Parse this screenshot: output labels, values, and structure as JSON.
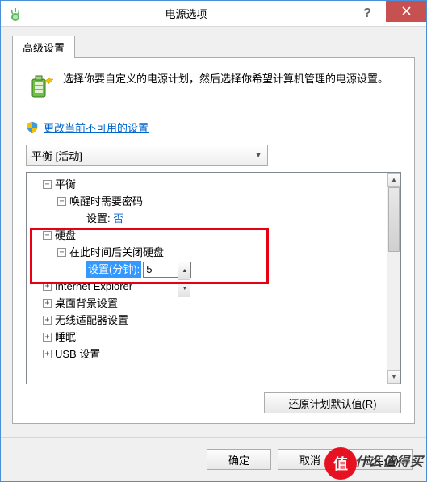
{
  "window": {
    "title": "电源选项"
  },
  "tab": {
    "label": "高级设置"
  },
  "intro": {
    "text": "选择你要自定义的电源计划，然后选择你希望计算机管理的电源设置。"
  },
  "link": {
    "change_unavailable": "更改当前不可用的设置"
  },
  "combo": {
    "selected": "平衡 [活动]"
  },
  "tree": {
    "balance": "平衡",
    "wake_password": "唤醒时需要密码",
    "wake_setting_label": "设置:",
    "wake_setting_value": "否",
    "hdd": "硬盘",
    "hdd_off_after": "在此时间后关闭硬盘",
    "hdd_setting_label": "设置(分钟):",
    "hdd_setting_value": "5",
    "ie": "Internet Explorer",
    "desktop_bg": "桌面背景设置",
    "wireless": "无线适配器设置",
    "sleep": "睡眠",
    "usb": "USB 设置"
  },
  "buttons": {
    "restore": "还原计划默认值(",
    "restore_key": "R",
    "restore_suffix": ")",
    "ok": "确定",
    "cancel": "取消",
    "apply": "应用(",
    "apply_key": "A",
    "apply_suffix": ")"
  },
  "watermark": {
    "char": "值",
    "text": "什么值得买"
  }
}
